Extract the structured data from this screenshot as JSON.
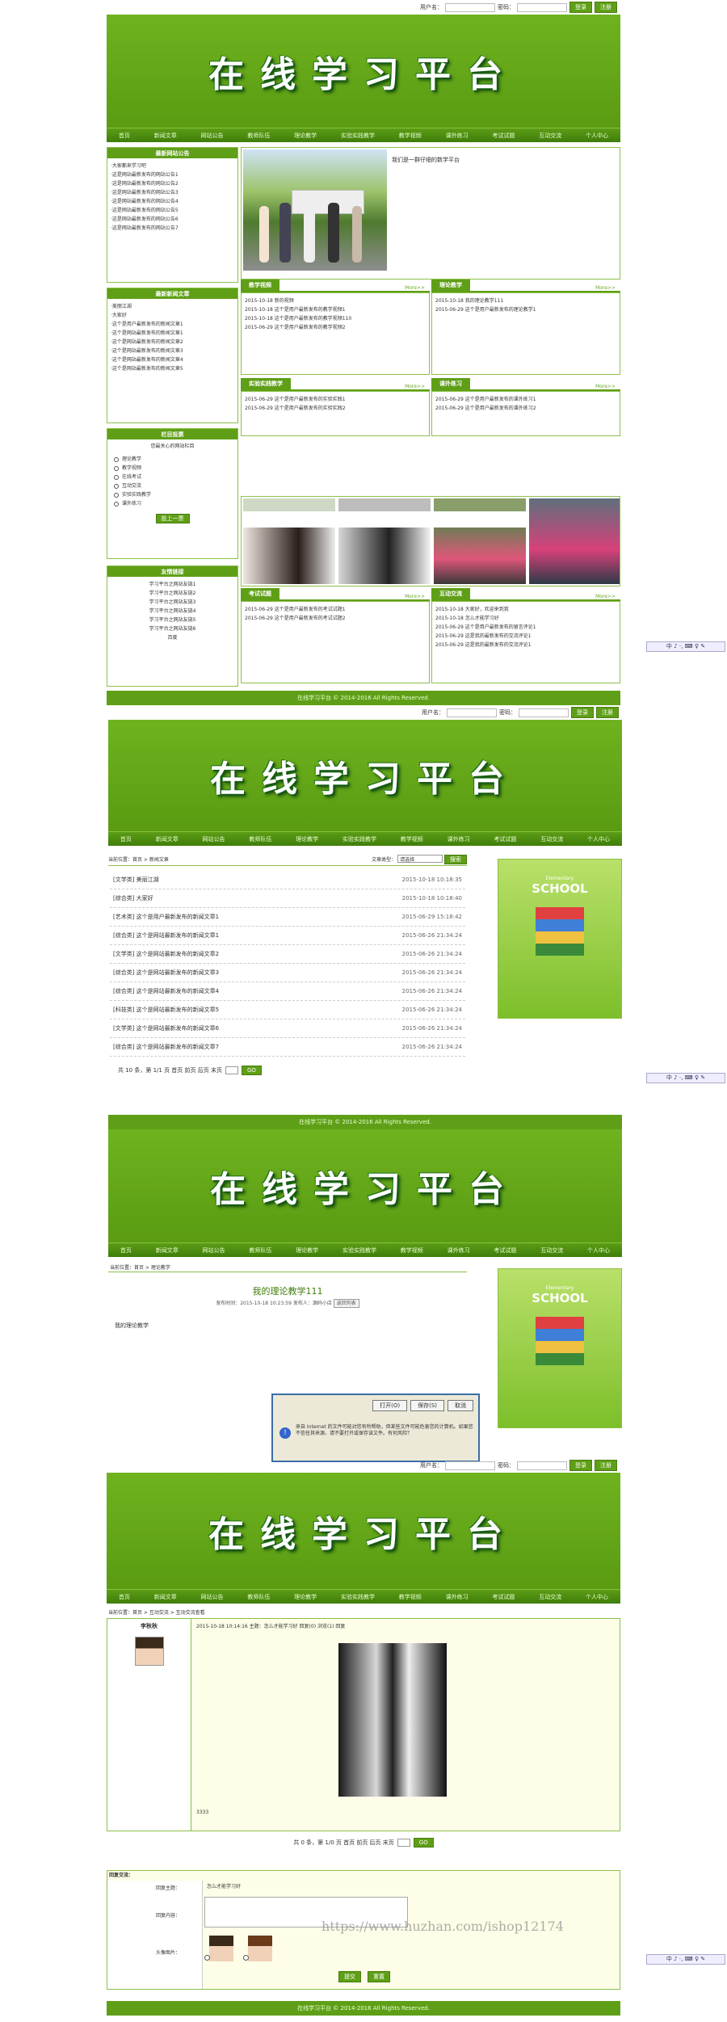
{
  "site": {
    "title": "在线学习平台",
    "username_label": "用户名：",
    "password_label": "密码：",
    "login": "登录",
    "register": "注册",
    "footer": "在线学习平台 © 2014-2016 All Rights Reserved."
  },
  "nav": [
    "首页",
    "新闻文章",
    "网站公告",
    "教师队伍",
    "理论教学",
    "实验实践教学",
    "教学视频",
    "课外练习",
    "考试试题",
    "互动交流",
    "个人中心"
  ],
  "p1": {
    "notice_title": "最新网站公告",
    "notices": [
      "·大家都来学习吧",
      "·这是网站最新发布的网站公告1",
      "·这是网站最新发布的网站公告2",
      "·这是网站最新发布的网站公告3",
      "·这是网站最新发布的网站公告4",
      "·这是网站最新发布的网站公告5",
      "·这是网站最新发布的网站公告6",
      "·这是网站最新发布的网站公告7"
    ],
    "welcome": "我们是一群仔细的数学平台",
    "news_title": "最新新闻文章",
    "news": [
      "·美丽江湖",
      "·大家好",
      "·这个是用户最新发布的新闻文章1",
      "·这个是网站最新发布的新闻文章1",
      "·这个是网站最新发布的新闻文章2",
      "·这个是网站最新发布的新闻文章3",
      "·这个是网站最新发布的新闻文章4",
      "·这个是网站最新发布的新闻文章5"
    ],
    "vote_title": "栏目投票",
    "vote_question": "您最关心的网站栏目",
    "vote_options": [
      "理论教学",
      "教学视频",
      "在线考试",
      "互动交流",
      "实验实践教学",
      "课外练习"
    ],
    "vote_btn": "投上一票",
    "links_title": "友情链接",
    "links": [
      "学习平台之网站友链1",
      "学习平台之网站友链2",
      "学习平台之网站友链3",
      "学习平台之网站友链4",
      "学习平台之网站友链5",
      "学习平台之网站友链6",
      "百度"
    ],
    "more": "More>>",
    "video_title": "教学视频",
    "videos": [
      "2015-10-18 新的视频",
      "2015-10-18 这个是用户最新发布的教学视频1",
      "2015-10-18 这个是用户最新发布的教学视频110",
      "2015-06-29 这个是用户最新发布的教学视频2"
    ],
    "theory_title": "理论教学",
    "theory": [
      "2015-10-18 我的理论教学111",
      "2015-06-29 这个是用户最新发布的理论教学1"
    ],
    "exp_title": "实验实践教学",
    "exp": [
      "2015-06-29 这个是用户最新发布的实验实践1",
      "2015-06-29 这个是用户最新发布的实验实践2"
    ],
    "ext_title": "课外练习",
    "ext": [
      "2015-06-29 这个是用户最新发布的课外练习1",
      "2015-06-29 这个是用户最新发布的课外练习2"
    ],
    "exam_title": "考试试题",
    "exam": [
      "2015-06-29 这个是用户最新发布的考试试题1",
      "2015-06-29 这个是用户最新发布的考试试题2"
    ],
    "inter_title": "互动交流",
    "inter": [
      "2015-10-18 大家好，欢迎来到我",
      "2015-10-18 怎么才能学习好",
      "2015-06-29 这个是用户最新发布的留言评论1",
      "2015-06-29 这是我的最新发布的交流评论1",
      "2015-06-29 这是我的最新发布的交流评论1"
    ]
  },
  "p2": {
    "crumb": "当前位置：首页 > 新闻文章",
    "type_label": "文章类型：",
    "type_value": "请选择",
    "search": "搜索",
    "rows": [
      [
        "[文学类] 美丽江湖",
        "2015-10-18 10:18:35"
      ],
      [
        "[综合类] 大家好",
        "2015-10-18 10:18:40"
      ],
      [
        "[艺术类] 这个是用户最新发布的新闻文章1",
        "2015-06-29 15:18:42"
      ],
      [
        "[综合类] 这个是网站最新发布的新闻文章1",
        "2015-06-26 21:34:24"
      ],
      [
        "[文学类] 这个是网站最新发布的新闻文章2",
        "2015-06-26 21:34:24"
      ],
      [
        "[综合类] 这个是网站最新发布的新闻文章3",
        "2015-06-26 21:34:24"
      ],
      [
        "[综合类] 这个是网站最新发布的新闻文章4",
        "2015-06-26 21:34:24"
      ],
      [
        "[科技类] 这个是网站最新发布的新闻文章5",
        "2015-06-26 21:34:24"
      ],
      [
        "[文学类] 这个是网站最新发布的新闻文章6",
        "2015-06-26 21:34:24"
      ],
      [
        "[综合类] 这个是网站最新发布的新闻文章7",
        "2015-06-26 21:34:24"
      ]
    ],
    "pager": "共 10 条，第 1/1 页  首页 前页 后页 末页",
    "go": "GO"
  },
  "p3": {
    "crumb": "当前位置：首页 > 理论教学",
    "title": "我的理论教学111",
    "meta": "发布时间：2015-10-18 10:23:59  发布人：源码小店",
    "back": "返回列表",
    "body": "我的理论教学",
    "dlg_open": "打开(O)",
    "dlg_save": "保存(S)",
    "dlg_cancel": "取消",
    "dlg_warn": "来自 Internet 的文件可能对您有所帮助，但某些文件可能危害您的计算机。如果您不信任其来源，请不要打开或保存该文件。有何风险？"
  },
  "p4": {
    "crumb": "当前位置：首页 > 互动交流 > 互动交流查看",
    "user": "李秋秋",
    "post_meta": "2015-10-18 10:14:16  主题：怎么才能学习好  回复(0)  浏览(1)  回复",
    "post_text": "3333",
    "pager": "共 0 条，第 1/0 页  首页 前页 后页 末页",
    "go": "GO",
    "form_head": "回复交流：",
    "f_title": "回复主题：",
    "f_title_val": "怎么才能学习好",
    "f_content": "回复内容：",
    "f_avatar": "头像图片：",
    "submit": "提交",
    "reset": "重置"
  },
  "ime": "中 ♪ ·, ⌨ ♀ ✎",
  "watermark": "https://www.huzhan.com/ishop12174",
  "school": "SCHOOL",
  "school_sub": "Elementary"
}
